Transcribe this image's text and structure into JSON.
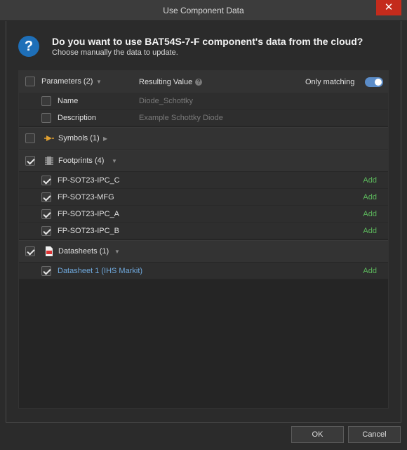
{
  "window": {
    "title": "Use Component Data",
    "close_glyph": "✕"
  },
  "header": {
    "icon_glyph": "?",
    "title": "Do you want to use BAT54S-7-F component's data from the cloud?",
    "subtitle": "Choose manually the data to update."
  },
  "parameters": {
    "label": "Parameters (2)",
    "column_header": "Resulting Value",
    "only_matching_label": "Only matching",
    "only_matching_on": true,
    "items": [
      {
        "name": "Name",
        "value": "Diode_Schottky"
      },
      {
        "name": "Description",
        "value": "Example Schottky Diode"
      }
    ]
  },
  "symbols": {
    "label": "Symbols (1)"
  },
  "footprints": {
    "label": "Footprints (4)",
    "items": [
      {
        "name": "FP-SOT23-IPC_C",
        "action": "Add"
      },
      {
        "name": "FP-SOT23-MFG",
        "action": "Add"
      },
      {
        "name": "FP-SOT23-IPC_A",
        "action": "Add"
      },
      {
        "name": "FP-SOT23-IPC_B",
        "action": "Add"
      }
    ]
  },
  "datasheets": {
    "label": "Datasheets (1)",
    "items": [
      {
        "name": "Datasheet 1 (IHS Markit)",
        "action": "Add"
      }
    ]
  },
  "buttons": {
    "ok": "OK",
    "cancel": "Cancel"
  },
  "colors": {
    "accent": "#1e6fb8",
    "add": "#5cb85c",
    "link": "#6fa8dc",
    "close": "#c42b1c"
  }
}
